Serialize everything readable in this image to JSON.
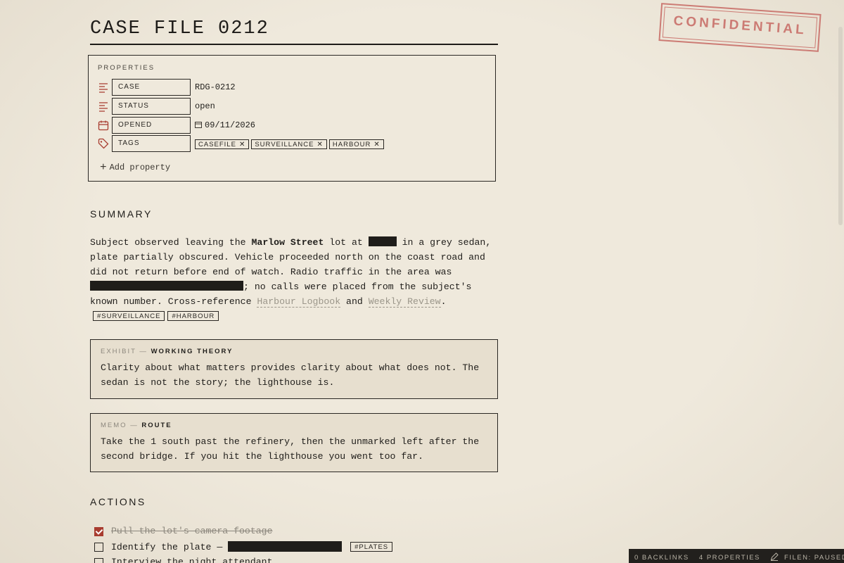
{
  "document": {
    "title": "CASE FILE 0212",
    "stamp": "CONFIDENTIAL"
  },
  "properties": {
    "heading": "PROPERTIES",
    "rows": [
      {
        "key": "CASE",
        "value": "RDG-0212",
        "icon": "text-lines-icon"
      },
      {
        "key": "STATUS",
        "value": "open",
        "icon": "text-lines-icon"
      },
      {
        "key": "OPENED",
        "value": "09/11/2026",
        "icon": "calendar-icon"
      },
      {
        "key": "TAGS",
        "icon": "tag-icon",
        "tags": [
          "CASEFILE",
          "SURVEILLANCE",
          "HARBOUR"
        ]
      }
    ],
    "add_label": "Add property"
  },
  "summary": {
    "heading": "SUMMARY",
    "t1": "Subject observed leaving the ",
    "bold": "Marlow Street",
    "t2": " lot at ",
    "t3": " in a grey sedan, plate partially obscured. Vehicle proceeded north on the coast road and did not return before end of watch. Radio traffic in the area was ",
    "t4": "; no calls were placed from the subject's known number. Cross-reference ",
    "link1": "Harbour Logbook",
    "t5": " and ",
    "link2": "Weekly Review",
    "t6": ".",
    "tags": [
      "#SURVEILLANCE",
      "#HARBOUR"
    ]
  },
  "exhibit": {
    "kind": "EXHIBIT",
    "title": "WORKING THEORY",
    "body": "Clarity about what matters provides clarity about what does not. The sedan is not the story; the lighthouse is."
  },
  "memo": {
    "kind": "MEMO",
    "title": "ROUTE",
    "body": "Take the 1 south past the refinery, then the unmarked left after the second bridge. If you hit the lighthouse you went too far."
  },
  "actions": {
    "heading": "ACTIONS",
    "items": [
      {
        "text": "Pull the lot's camera footage",
        "done": true
      },
      {
        "text": "Identify the plate —",
        "done": false,
        "tag": "#PLATES"
      },
      {
        "text": "Interview the night attendant",
        "done": false
      }
    ]
  },
  "statusbar": {
    "backlinks": "0 BACKLINKS",
    "properties": "4 PROPERTIES",
    "mode": "FILEN: PAUSED"
  },
  "colors": {
    "background": "#efe9dc",
    "accent": "#a83c2f",
    "stamp": "#c9706a",
    "ink": "#1f1d1a"
  }
}
